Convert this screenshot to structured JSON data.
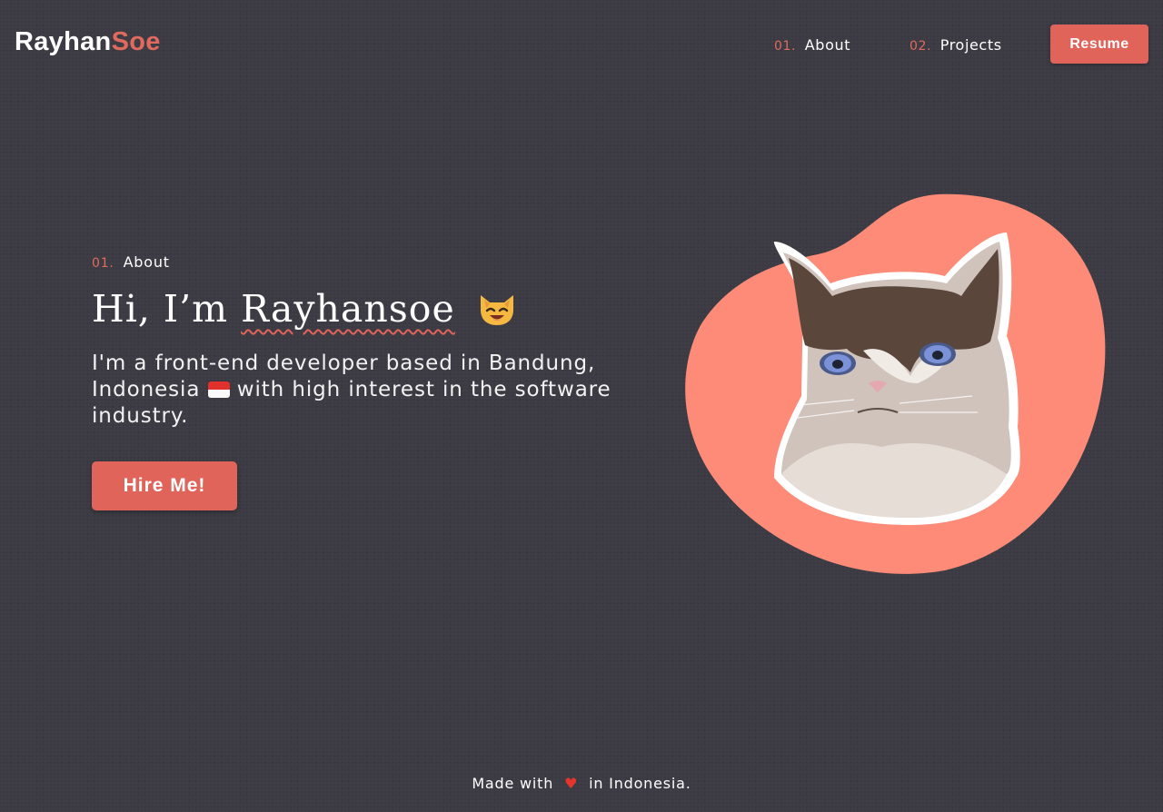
{
  "brand": {
    "name_part1": "Rayhan",
    "name_part2": "Soe",
    "accent_color": "#e06a5e"
  },
  "nav": {
    "items": [
      {
        "number": "01.",
        "label": "About"
      },
      {
        "number": "02.",
        "label": "Projects"
      }
    ],
    "resume_label": "Resume"
  },
  "hero": {
    "section_number": "01.",
    "section_label": "About",
    "greeting": "Hi, I’m",
    "name": "Rayhansoe",
    "emoji_icon": "cat-face-icon",
    "intro_part1": "I'm a front-end developer based in Bandung, Indonesia",
    "flag_icon": "indonesia-flag-icon",
    "intro_part2": "with high interest in the software industry.",
    "cta_label": "Hire Me!"
  },
  "illustration": {
    "blob_color": "#fd8b77",
    "subject": "grumpy-cat-photo"
  },
  "footer": {
    "text_before": "Made with",
    "heart_icon": "heart-icon",
    "text_after": "in Indonesia."
  }
}
